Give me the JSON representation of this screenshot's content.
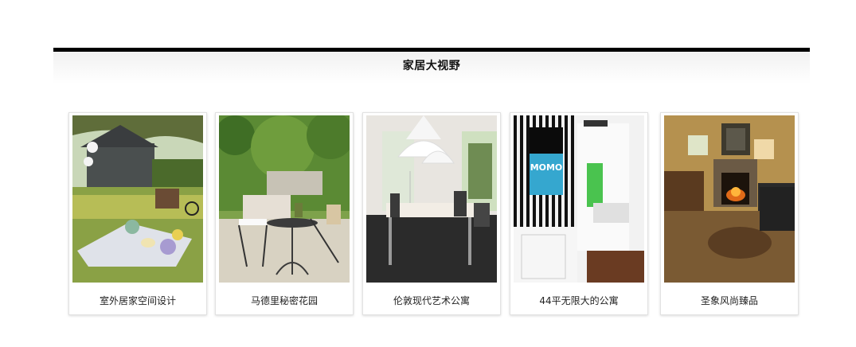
{
  "section": {
    "title": "家居大视野"
  },
  "cards": [
    {
      "caption": "室外居家空间设计",
      "image": "outdoor-picnic-photo"
    },
    {
      "caption": "马德里秘密花园",
      "image": "garden-bistro-photo"
    },
    {
      "caption": "伦敦现代艺术公寓",
      "image": "modern-dining-photo"
    },
    {
      "caption": "44平无限大的公寓",
      "image": "apartment-poster-photo"
    },
    {
      "caption": "圣象风尚臻品",
      "image": "fireplace-living-photo"
    }
  ]
}
